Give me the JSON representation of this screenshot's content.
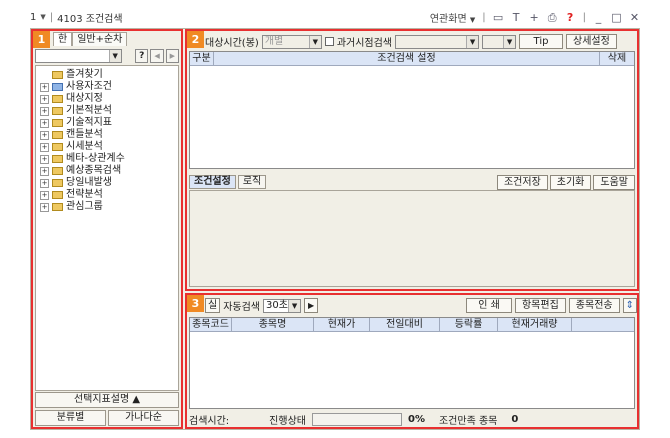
{
  "titlebar": {
    "dropdown": "1",
    "screen": "4103 조건검색",
    "linked": "연관화면",
    "icons": [
      "monitor-icon",
      "text-icon",
      "plus-icon",
      "print-icon",
      "help-icon",
      "minimize-icon",
      "maximize-icon",
      "close-icon"
    ],
    "icon_glyphs": [
      "▭",
      "T",
      "+",
      "⎙",
      "?",
      "_",
      "□",
      "✕"
    ]
  },
  "badges": [
    "1",
    "2",
    "3"
  ],
  "left": {
    "tabs": [
      "한",
      "일반+순차"
    ],
    "help": "?",
    "prev": "◀",
    "next": "▶",
    "tree": [
      {
        "label": "즐겨찾기",
        "expand": "",
        "folder": "yellow"
      },
      {
        "label": "사용자조건",
        "expand": "+",
        "folder": "blue"
      },
      {
        "label": "대상지정",
        "expand": "+",
        "folder": "yellow"
      },
      {
        "label": "기본적분석",
        "expand": "+",
        "folder": "yellow"
      },
      {
        "label": "기술적지표",
        "expand": "+",
        "folder": "yellow"
      },
      {
        "label": "캔들분석",
        "expand": "+",
        "folder": "yellow"
      },
      {
        "label": "시세분석",
        "expand": "+",
        "folder": "yellow"
      },
      {
        "label": "베타-상관계수",
        "expand": "+",
        "folder": "yellow"
      },
      {
        "label": "예상종목검색",
        "expand": "+",
        "folder": "yellow"
      },
      {
        "label": "당일내발생",
        "expand": "+",
        "folder": "yellow"
      },
      {
        "label": "전략분석",
        "expand": "+",
        "folder": "yellow"
      },
      {
        "label": "관심그룹",
        "expand": "+",
        "folder": "yellow"
      }
    ],
    "desc_button": "선택지표설명 ▲",
    "sort_by_category": "분류별",
    "sort_by_alpha": "가나다순"
  },
  "condition": {
    "target_time_label": "대상시간(봉)",
    "target_time_value": "개별",
    "past_search_label": "과거시점검색",
    "tip": "Tip",
    "detail": "상세설정",
    "columns": [
      "구분",
      "조건검색 설정",
      "삭제"
    ],
    "tabs": [
      "조건설정",
      "로직"
    ],
    "save": "조건저장",
    "reset": "초기화",
    "help": "도움말"
  },
  "results": {
    "realtime": "실",
    "auto_search": "자동검색",
    "interval": "30초",
    "play": "▶",
    "print": "인 쇄",
    "edit_items": "항목편집",
    "send": "종목전송",
    "scroll": "⇕",
    "columns": [
      "종목코드",
      "종목명",
      "현재가",
      "전일대비",
      "등락률",
      "현재거래량"
    ],
    "search_time_label": "검색시간:",
    "progress_label": "진행상태",
    "progress_percent": "0%",
    "match_label": "조건만족 종목",
    "match_count": "0"
  }
}
